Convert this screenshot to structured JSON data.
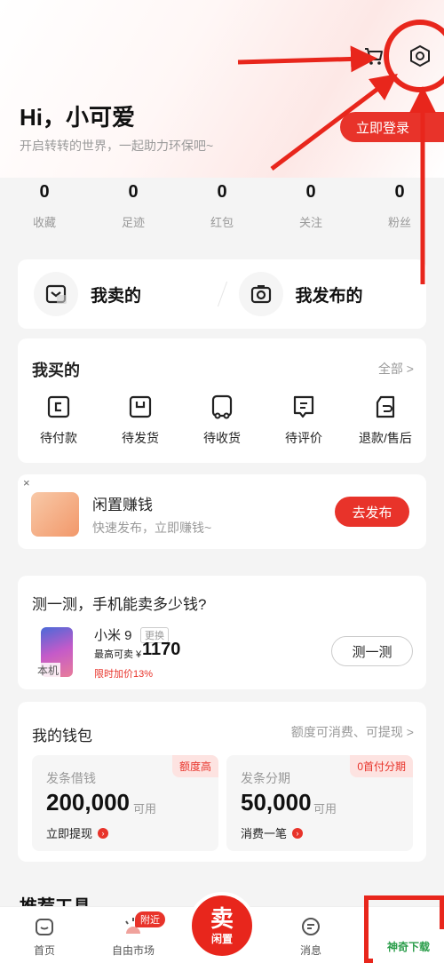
{
  "header": {
    "greeting": "Hi，小可爱",
    "subtitle": "开启转转的世界，一起助力环保吧~",
    "login_label": "立即登录",
    "cart_icon": "cart-icon",
    "settings_icon": "settings-icon"
  },
  "stats": [
    {
      "value": "0",
      "label": "收藏"
    },
    {
      "value": "0",
      "label": "足迹"
    },
    {
      "value": "0",
      "label": "红包"
    },
    {
      "value": "0",
      "label": "关注"
    },
    {
      "value": "0",
      "label": "粉丝"
    }
  ],
  "sell": {
    "my_sold": "我卖的",
    "my_posted": "我发布的"
  },
  "bought": {
    "title": "我买的",
    "all": "全部 >",
    "items": [
      {
        "label": "待付款",
        "icon": "wallet-icon"
      },
      {
        "label": "待发货",
        "icon": "package-icon"
      },
      {
        "label": "待收货",
        "icon": "truck-icon"
      },
      {
        "label": "待评价",
        "icon": "comment-icon"
      },
      {
        "label": "退款/售后",
        "icon": "return-icon"
      }
    ]
  },
  "idle": {
    "close": "×",
    "title": "闲置赚钱",
    "subtitle": "快速发布，立即赚钱~",
    "button": "去发布"
  },
  "phone": {
    "title": "测一测，手机能卖多少钱?",
    "model": "小米 9",
    "swap": "更换",
    "price_label": "最高可卖 ¥",
    "price": "1170",
    "hint": "限时加价13%",
    "tag": "本机",
    "button": "测一测"
  },
  "wallet": {
    "title": "我的钱包",
    "note": "额度可消费、可提现 >",
    "loan": {
      "name": "发条借钱",
      "amount": "200,000",
      "avail": "可用",
      "badge": "额度高",
      "link": "立即提现"
    },
    "install": {
      "name": "发条分期",
      "amount": "50,000",
      "avail": "可用",
      "badge": "0首付分期",
      "link": "消费一笔"
    }
  },
  "recommend_title": "推荐工具",
  "tabbar": {
    "home": "首页",
    "market": "自由市场",
    "near_badge": "附近",
    "sell_big": "卖",
    "sell_small": "闲置",
    "messages": "消息",
    "watermark": "神奇下载"
  },
  "colors": {
    "accent": "#e8332a",
    "annotation": "#e8261c"
  }
}
